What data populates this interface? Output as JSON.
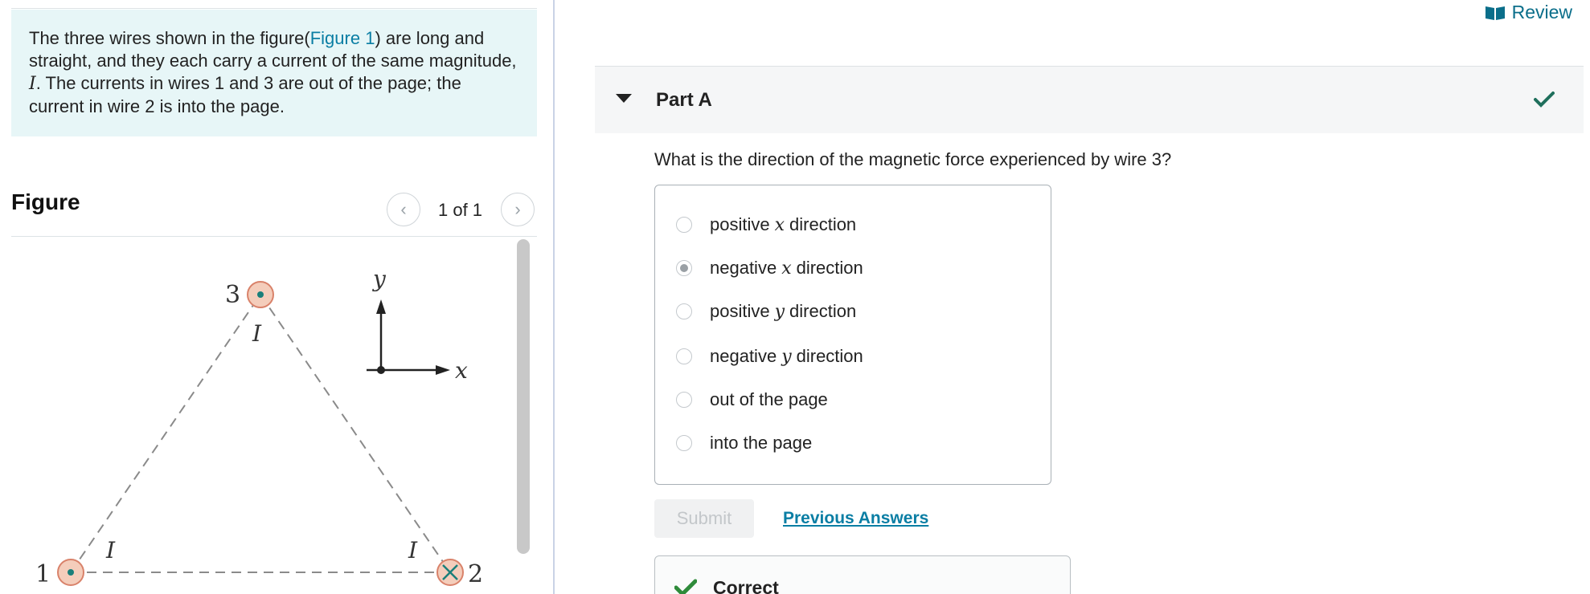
{
  "problem": {
    "text_before_link": "The three wires shown in the figure(",
    "link": "Figure 1",
    "text_after_link": ") are long and straight, and they each carry a current of the same magnitude,",
    "current_symbol": "I",
    "text_end": ". The currents in wires 1 and 3 are out of the page; the current in wire 2 is into the page."
  },
  "figure": {
    "title": "Figure",
    "prev_glyph": "‹",
    "next_glyph": "›",
    "page_counter": "1 of 1",
    "labels": {
      "wire1": "1",
      "wire2": "2",
      "wire3": "3",
      "current": "I",
      "axis_x": "x",
      "axis_y": "y"
    },
    "colors": {
      "wire_fill": "#f4cdbb",
      "wire_stroke": "#d9826a",
      "dot": "#1a7f7a"
    }
  },
  "header": {
    "review_label": "Review"
  },
  "part": {
    "title": "Part A",
    "question": "What is the direction of the magnetic force experienced by wire 3?",
    "options": [
      {
        "pre": "positive",
        "sym": "x",
        "post": "direction",
        "selected": false
      },
      {
        "pre": "negative",
        "sym": "x",
        "post": "direction",
        "selected": true
      },
      {
        "pre": "positive",
        "sym": "y",
        "post": "direction",
        "selected": false
      },
      {
        "pre": "negative",
        "sym": "y",
        "post": "direction",
        "selected": false
      },
      {
        "pre": "out of the page",
        "sym": "",
        "post": "",
        "selected": false
      },
      {
        "pre": "into the page",
        "sym": "",
        "post": "",
        "selected": false
      }
    ],
    "submit_label": "Submit",
    "previous_answers_label": "Previous Answers",
    "result_label": "Correct"
  },
  "colors": {
    "accent": "#0a7ea4",
    "check": "#1f6f5c",
    "correct_green": "#2e8b3a"
  }
}
